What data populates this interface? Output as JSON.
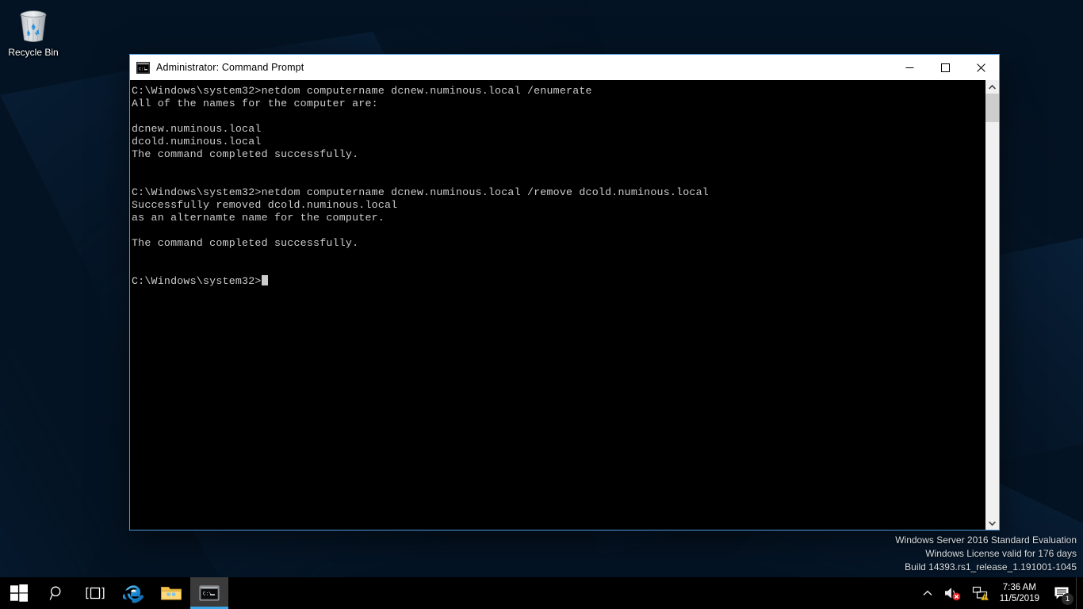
{
  "desktop": {
    "icons": [
      {
        "name": "recycle-bin",
        "label": "Recycle Bin"
      }
    ],
    "background_color": "#041323",
    "accent_color": "#3ba7ec"
  },
  "window": {
    "title": "Administrator: Command Prompt",
    "icon": "console-icon",
    "border_color": "#4a9ae0",
    "titlebar_bg": "#ffffff",
    "titlebar_fg": "#000000",
    "controls": {
      "minimize": "minimize-icon",
      "maximize": "maximize-icon",
      "close": "close-icon"
    },
    "console": {
      "bg": "#000000",
      "fg": "#cccccc",
      "lines": [
        "C:\\Windows\\system32>netdom computername dcnew.numinous.local /enumerate",
        "All of the names for the computer are:",
        "",
        "dcnew.numinous.local",
        "dcold.numinous.local",
        "The command completed successfully.",
        "",
        "",
        "C:\\Windows\\system32>netdom computername dcnew.numinous.local /remove dcold.numinous.local",
        "Successfully removed dcold.numinous.local",
        "as an alternamte name for the computer.",
        "",
        "The command completed successfully.",
        "",
        "",
        "C:\\Windows\\system32>"
      ],
      "prompt_last": "C:\\Windows\\system32>",
      "cursor": "block-caret"
    },
    "scrollbar": {
      "up_arrow": "chevron-up-icon",
      "down_arrow": "chevron-down-icon",
      "thumb_position": "top"
    }
  },
  "watermark": {
    "line1": "Windows Server 2016 Standard Evaluation",
    "line2": "Windows License valid for 176 days",
    "line3": "Build 14393.rs1_release_1.191001-1045"
  },
  "taskbar": {
    "start": {
      "label": "Start",
      "icon": "windows-logo-icon"
    },
    "search": {
      "label": "Search",
      "icon": "search-icon"
    },
    "task_view": {
      "label": "Task View",
      "icon": "task-view-icon"
    },
    "pinned": [
      {
        "name": "internet-explorer",
        "label": "Internet Explorer",
        "icon": "internet-explorer-icon",
        "active": false
      },
      {
        "name": "file-explorer",
        "label": "File Explorer",
        "icon": "folder-icon",
        "active": false
      },
      {
        "name": "command-prompt",
        "label": "Command Prompt",
        "icon": "console-icon",
        "active": true
      }
    ],
    "tray": {
      "show_hidden": {
        "label": "Show hidden icons",
        "icon": "chevron-up-icon"
      },
      "volume": {
        "label": "Volume muted",
        "icon": "speaker-muted-icon"
      },
      "network": {
        "label": "Network warning",
        "icon": "network-warning-icon"
      },
      "clock": {
        "time": "7:36 AM",
        "date": "11/5/2019"
      },
      "action_center": {
        "label": "Action Center",
        "icon": "notification-icon",
        "badge": "1"
      }
    }
  }
}
